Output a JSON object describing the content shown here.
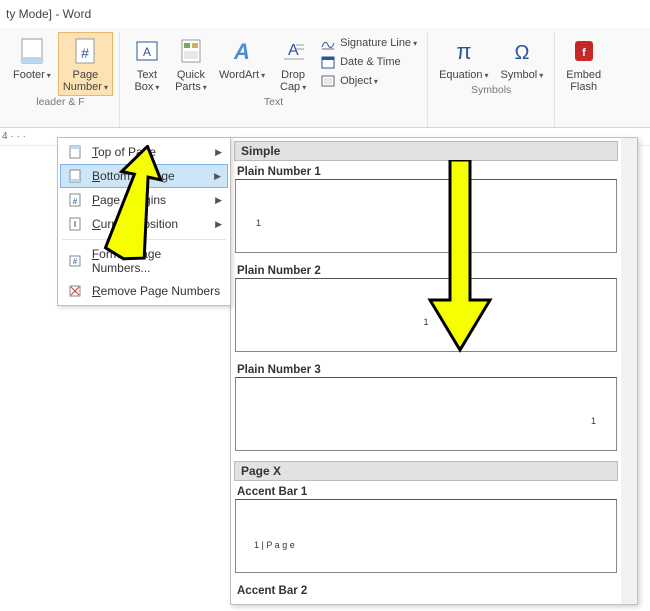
{
  "window": {
    "title_suffix": "ty Mode] - Word"
  },
  "ribbon": {
    "footer": "Footer",
    "page_number": "Page\nNumber",
    "text_box": "Text\nBox",
    "quick_parts": "Quick\nParts",
    "wordart": "WordArt",
    "drop_cap": "Drop\nCap",
    "signature": "Signature Line",
    "date_time": "Date & Time",
    "object": "Object",
    "equation": "Equation",
    "symbol": "Symbol",
    "embed_flash": "Embed\nFlash",
    "group_header_footer": "leader & F",
    "group_text": "Text",
    "group_symbols": "Symbols"
  },
  "ruler": "4  ·  ·  ·",
  "menu": {
    "top_of_page": "Top of Page",
    "bottom_of_page": "Bottom of Page",
    "page_margins": "Page Margins",
    "current_position": "Current Position",
    "format_numbers": "Format Page Numbers...",
    "remove_numbers": "Remove Page Numbers"
  },
  "gallery": {
    "cat_simple": "Simple",
    "plain1": "Plain Number 1",
    "plain2": "Plain Number 2",
    "plain3": "Plain Number 3",
    "cat_pagex": "Page X",
    "accent1": "Accent Bar 1",
    "accent1_text": "1 | P a g e",
    "accent2": "Accent Bar 2",
    "num1": "1"
  }
}
